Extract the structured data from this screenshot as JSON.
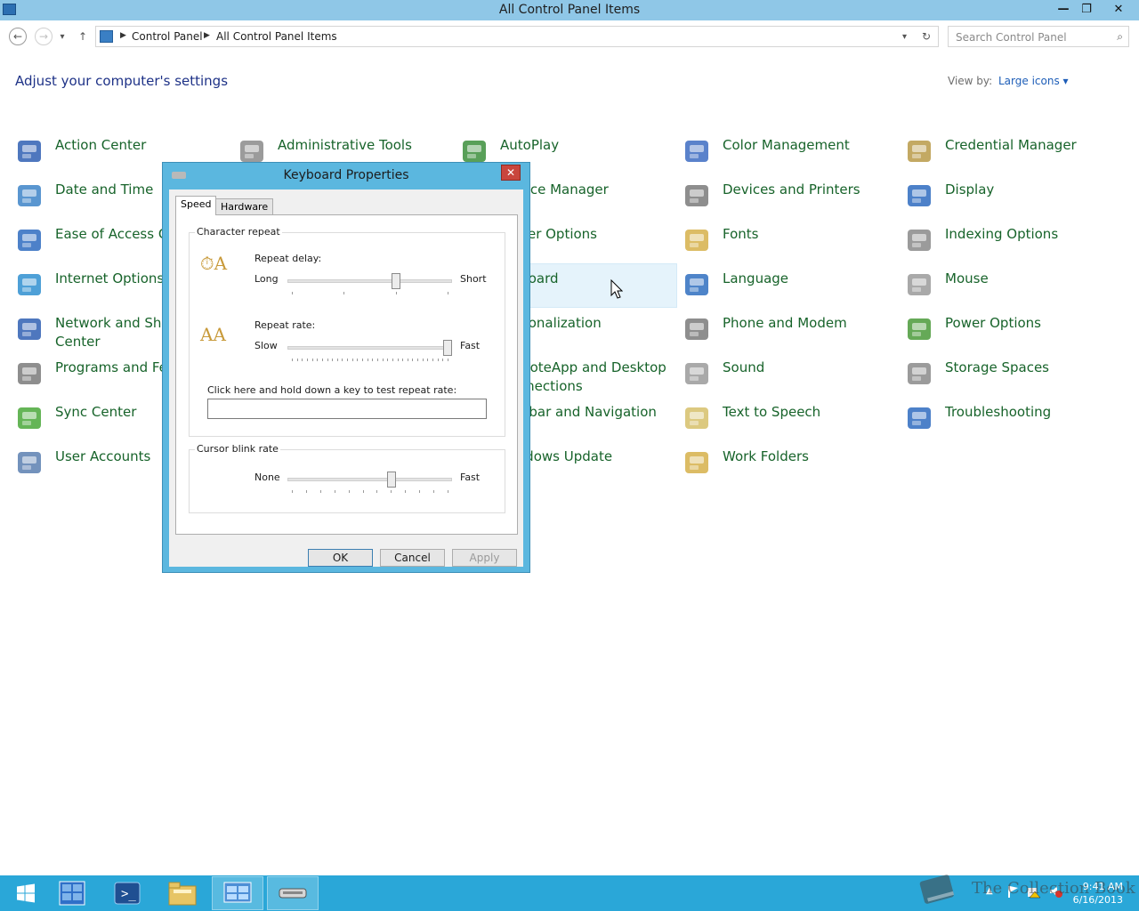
{
  "window": {
    "title": "All Control Panel Items",
    "min_glyph": "—",
    "restore_glyph": "❐",
    "close_glyph": "✕"
  },
  "nav": {
    "back_glyph": "←",
    "forward_glyph": "→",
    "dropdown_glyph": "▾",
    "up_glyph": "↑",
    "breadcrumb": [
      "Control Panel",
      "All Control Panel Items"
    ],
    "sep_glyph": "▶",
    "refresh_glyph": "↻",
    "search_placeholder": "Search Control Panel",
    "search_glyph": "⌕"
  },
  "header": {
    "heading": "Adjust your computer's settings",
    "viewby_label": "View by:",
    "viewby_value": "Large icons ▾"
  },
  "items": [
    {
      "label": "Action Center",
      "icon": "flag-icon",
      "color": "#2f5fb3"
    },
    {
      "label": "Administrative Tools",
      "icon": "gear-icon",
      "color": "#8a8a8a"
    },
    {
      "label": "AutoPlay",
      "icon": "autoplay-icon",
      "color": "#3c8f3c"
    },
    {
      "label": "Color Management",
      "icon": "color-management-icon",
      "color": "#3d6cc2"
    },
    {
      "label": "Credential Manager",
      "icon": "vault-icon",
      "color": "#b89a48"
    },
    {
      "label": "Date and Time",
      "icon": "calendar-clock-icon",
      "color": "#3d84c8"
    },
    {
      "label": "Device Manager",
      "icon": "device-manager-icon",
      "color": "#6a6a6a"
    },
    {
      "label": "Devices and Printers",
      "icon": "printer-icon",
      "color": "#7a7a7a"
    },
    {
      "label": "Display",
      "icon": "monitor-icon",
      "color": "#2e6bc0"
    },
    {
      "label": "Ease of Access Center",
      "icon": "ease-of-access-icon",
      "color": "#2e6bc0"
    },
    {
      "label": "Folder Options",
      "icon": "folder-options-icon",
      "color": "#d6b04a"
    },
    {
      "label": "Fonts",
      "icon": "fonts-icon",
      "color": "#d6b04a"
    },
    {
      "label": "Indexing Options",
      "icon": "magnifier-icon",
      "color": "#8a8a8a"
    },
    {
      "label": "Internet Options",
      "icon": "globe-icon",
      "color": "#2f8fd0"
    },
    {
      "label": "Keyboard",
      "icon": "keyboard-icon",
      "color": "#8a8a8a"
    },
    {
      "label": "Language",
      "icon": "language-icon",
      "color": "#2f6fc0"
    },
    {
      "label": "Mouse",
      "icon": "mouse-icon",
      "color": "#9a9a9a"
    },
    {
      "label": "Network and Sharing Center",
      "icon": "network-icon",
      "color": "#2f5fb3"
    },
    {
      "label": "Personalization",
      "icon": "personalization-icon",
      "color": "#3f7fc8"
    },
    {
      "label": "Phone and Modem",
      "icon": "phone-icon",
      "color": "#7a7a7a"
    },
    {
      "label": "Power Options",
      "icon": "battery-icon",
      "color": "#4a9a3a"
    },
    {
      "label": "Programs and Features",
      "icon": "programs-icon",
      "color": "#7a7a7a"
    },
    {
      "label": "RemoteApp and Desktop Connections",
      "icon": "remote-desktop-icon",
      "color": "#3a6fc0"
    },
    {
      "label": "Sound",
      "icon": "speaker-icon",
      "color": "#9a9a9a"
    },
    {
      "label": "Storage Spaces",
      "icon": "storage-icon",
      "color": "#8a8a8a"
    },
    {
      "label": "Sync Center",
      "icon": "sync-icon",
      "color": "#4aa83a"
    },
    {
      "label": "Taskbar and Navigation",
      "icon": "taskbar-icon",
      "color": "#3a6fc0"
    },
    {
      "label": "Text to Speech",
      "icon": "speech-icon",
      "color": "#d6c06a"
    },
    {
      "label": "Troubleshooting",
      "icon": "troubleshoot-icon",
      "color": "#2e6bc0"
    },
    {
      "label": "User Accounts",
      "icon": "users-icon",
      "color": "#5a7fb0"
    },
    {
      "label": "Windows Update",
      "icon": "windows-update-icon",
      "color": "#2f6fc0"
    },
    {
      "label": "Work Folders",
      "icon": "work-folders-icon",
      "color": "#d6b04a"
    }
  ],
  "dialog": {
    "title": "Keyboard Properties",
    "close_glyph": "✕",
    "tabs": [
      "Speed",
      "Hardware"
    ],
    "character_repeat": {
      "group_title": "Character repeat",
      "repeat_delay_label": "Repeat delay:",
      "delay_min_label": "Long",
      "delay_max_label": "Short",
      "repeat_delay_value": 0.67,
      "repeat_rate_label": "Repeat rate:",
      "rate_min_label": "Slow",
      "rate_max_label": "Fast",
      "repeat_rate_value": 1.0,
      "test_label": "Click here and hold down a key to test repeat rate:",
      "test_value": ""
    },
    "cursor_blink": {
      "group_title": "Cursor blink rate",
      "min_label": "None",
      "max_label": "Fast",
      "value": 0.64
    },
    "buttons": {
      "ok": "OK",
      "cancel": "Cancel",
      "apply": "Apply"
    }
  },
  "taskbar": {
    "time": "9:41 AM",
    "date": "6/16/2013",
    "watermark": "The Collection Book",
    "tray_up_glyph": "▲"
  }
}
